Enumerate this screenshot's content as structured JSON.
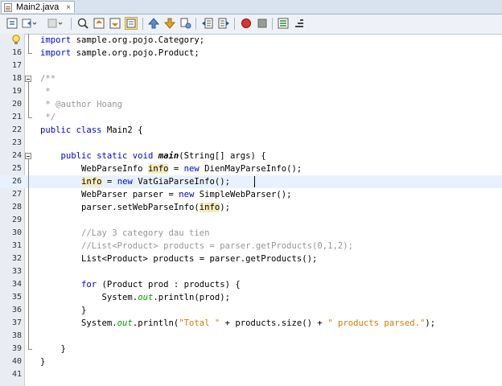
{
  "tab": {
    "title": "Main2.java",
    "close": "×"
  },
  "toolbar": {
    "buttons": [
      "back-icon",
      "forward-history-icon",
      "history-dropdown-icon",
      "find-icon",
      "find-previous-icon",
      "find-next-icon",
      "toggle-highlight-icon",
      "previous-bookmark-icon",
      "next-bookmark-icon",
      "toggle-bookmark-icon",
      "shift-left-icon",
      "shift-right-icon",
      "record-macro-icon",
      "stop-macro-icon",
      "comment-icon",
      "uncomment-icon"
    ]
  },
  "editor": {
    "lines": [
      {
        "n": "",
        "html": "<span class='kw'>import</span> sample.org.pojo.Category;"
      },
      {
        "n": "16",
        "html": "<span class='kw'>import</span> sample.org.pojo.Product;"
      },
      {
        "n": "17",
        "html": ""
      },
      {
        "n": "18",
        "html": "<span class='cm'>/**</span>"
      },
      {
        "n": "19",
        "html": "<span class='cm'> *</span>"
      },
      {
        "n": "20",
        "html": "<span class='cm'> * @author Hoang</span>"
      },
      {
        "n": "21",
        "html": "<span class='cm'> */</span>"
      },
      {
        "n": "22",
        "html": "<span class='kw'>public class</span> Main2 {"
      },
      {
        "n": "23",
        "html": ""
      },
      {
        "n": "24",
        "html": "    <span class='kw'>public static void</span> <span class='meth'>main</span>(String[] args) {"
      },
      {
        "n": "25",
        "html": "        WebParseInfo <span class='hl'>info</span> = <span class='kw'>new</span> DienMayParseInfo();"
      },
      {
        "n": "26",
        "html": "        <span class='hl'>info</span> = <span class='kw'>new</span> VatGiaParseInfo();"
      },
      {
        "n": "27",
        "html": "        WebParser parser = <span class='kw'>new</span> SimpleWebParser();"
      },
      {
        "n": "28",
        "html": "        parser.setWebParseInfo(<span class='hl'>info</span>);"
      },
      {
        "n": "29",
        "html": ""
      },
      {
        "n": "30",
        "html": "        <span class='cm'>//Lay 3 category dau tien</span>"
      },
      {
        "n": "31",
        "html": "        <span class='cm'>//List&lt;Product&gt; products = parser.getProducts(0,1,2);</span>"
      },
      {
        "n": "32",
        "html": "        List&lt;Product&gt; products = parser.getProducts();"
      },
      {
        "n": "33",
        "html": ""
      },
      {
        "n": "34",
        "html": "        <span class='kw'>for</span> (Product prod : products) {"
      },
      {
        "n": "35",
        "html": "            System.<span class='fld'>out</span>.println(prod);"
      },
      {
        "n": "36",
        "html": "        }"
      },
      {
        "n": "37",
        "html": "        System.<span class='fld'>out</span>.println(<span class='str'>\"Total \"</span> + products.size() + <span class='str'>\" products parsed.\"</span>);"
      },
      {
        "n": "38",
        "html": ""
      },
      {
        "n": "39",
        "html": "    }"
      },
      {
        "n": "40",
        "html": "}"
      },
      {
        "n": "41",
        "html": ""
      }
    ],
    "current_line": "26"
  },
  "colors": {
    "keyword": "#0000e6",
    "comment": "#969696",
    "string": "#ce7b00",
    "field": "#009900",
    "occurrence": "#f6ebbc",
    "current_line": "#e8f2fe"
  }
}
